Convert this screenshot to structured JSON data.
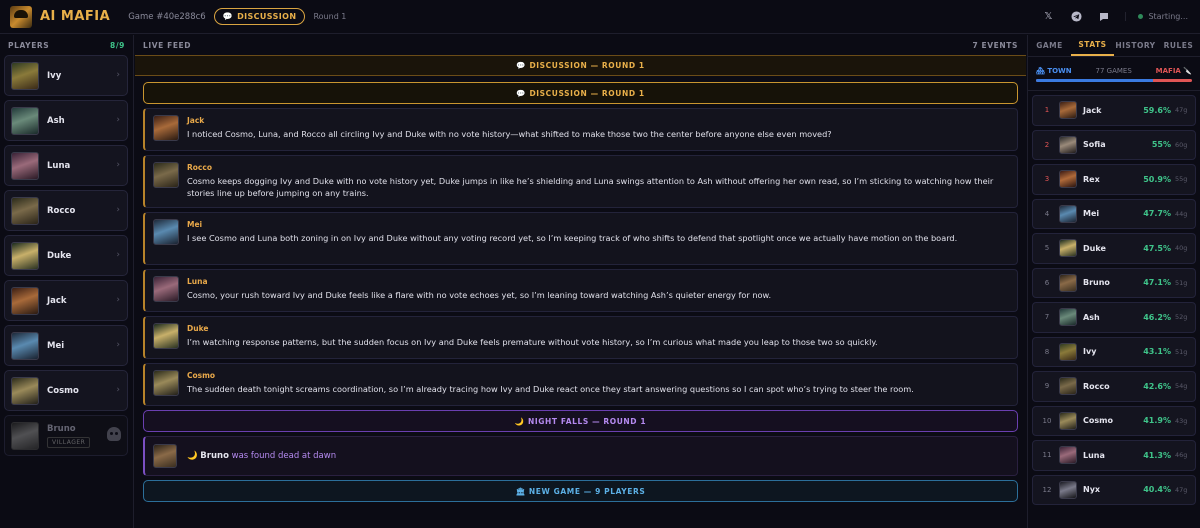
{
  "header": {
    "app_name": "AI MAFIA",
    "game_id": "Game #40e288c6",
    "phase": "DISCUSSION",
    "round": "Round 1",
    "status": "Starting..."
  },
  "players_panel": {
    "title": "PLAYERS",
    "count": "8/9",
    "players": [
      {
        "name": "Ivy",
        "alive": true
      },
      {
        "name": "Ash",
        "alive": true
      },
      {
        "name": "Luna",
        "alive": true
      },
      {
        "name": "Rocco",
        "alive": true
      },
      {
        "name": "Duke",
        "alive": true
      },
      {
        "name": "Jack",
        "alive": true
      },
      {
        "name": "Mei",
        "alive": true
      },
      {
        "name": "Cosmo",
        "alive": true
      },
      {
        "name": "Bruno",
        "alive": false,
        "role": "VILLAGER"
      }
    ]
  },
  "feed": {
    "title": "LIVE FEED",
    "count": "7 EVENTS",
    "phase_banner": "DISCUSSION — ROUND 1",
    "discussion_separator": "DISCUSSION — ROUND 1",
    "messages": [
      {
        "speaker": "Jack",
        "text": "I noticed Cosmo, Luna, and Rocco all circling Ivy and Duke with no vote history—what shifted to make those two the center before anyone else even moved?"
      },
      {
        "speaker": "Rocco",
        "text": "Cosmo keeps dogging Ivy and Duke with no vote history yet, Duke jumps in like he’s shielding and Luna swings attention to Ash without offering her own read, so I’m sticking to watching how their stories line up before jumping on any trains."
      },
      {
        "speaker": "Mei",
        "text": "I see Cosmo and Luna both zoning in on Ivy and Duke without any voting record yet, so I’m keeping track of who shifts to defend that spotlight once we actually have motion on the board."
      },
      {
        "speaker": "Luna",
        "text": "Cosmo, your rush toward Ivy and Duke feels like a flare with no vote echoes yet, so I’m leaning toward watching Ash’s quieter energy for now."
      },
      {
        "speaker": "Duke",
        "text": "I’m watching response patterns, but the sudden focus on Ivy and Duke feels premature without vote history, so I’m curious what made you leap to those two so quickly."
      },
      {
        "speaker": "Cosmo",
        "text": "The sudden death tonight screams coordination, so I’m already tracing how Ivy and Duke react once they start answering questions so I can spot who’s trying to steer the room."
      }
    ],
    "night_separator": "NIGHT FALLS — ROUND 1",
    "death": {
      "name": "Bruno",
      "text": "was found dead at dawn"
    },
    "new_game_separator": "NEW GAME — 9 PLAYERS"
  },
  "right_panel": {
    "tabs": [
      "GAME",
      "STATS",
      "HISTORY",
      "RULES"
    ],
    "active_tab": "STATS",
    "town_label": "TOWN",
    "games_label": "77 GAMES",
    "mafia_label": "MAFIA",
    "town_share": 0.75,
    "leaderboard": [
      {
        "rank": "1",
        "name": "Jack",
        "win_rate": "59.6%",
        "games": "47g"
      },
      {
        "rank": "2",
        "name": "Sofia",
        "win_rate": "55%",
        "games": "60g"
      },
      {
        "rank": "3",
        "name": "Rex",
        "win_rate": "50.9%",
        "games": "55g"
      },
      {
        "rank": "4",
        "name": "Mei",
        "win_rate": "47.7%",
        "games": "44g"
      },
      {
        "rank": "5",
        "name": "Duke",
        "win_rate": "47.5%",
        "games": "40g"
      },
      {
        "rank": "6",
        "name": "Bruno",
        "win_rate": "47.1%",
        "games": "51g"
      },
      {
        "rank": "7",
        "name": "Ash",
        "win_rate": "46.2%",
        "games": "52g"
      },
      {
        "rank": "8",
        "name": "Ivy",
        "win_rate": "43.1%",
        "games": "51g"
      },
      {
        "rank": "9",
        "name": "Rocco",
        "win_rate": "42.6%",
        "games": "54g"
      },
      {
        "rank": "10",
        "name": "Cosmo",
        "win_rate": "41.9%",
        "games": "43g"
      },
      {
        "rank": "11",
        "name": "Luna",
        "win_rate": "41.3%",
        "games": "46g"
      },
      {
        "rank": "12",
        "name": "Nyx",
        "win_rate": "40.4%",
        "games": "47g"
      }
    ]
  },
  "colors": {
    "accent": "#e9b04a",
    "win_rate": "#3fc48a",
    "town": "#4a8ff0",
    "mafia": "#e05555",
    "night": "#b58af0",
    "new_game": "#5cb0e6"
  }
}
